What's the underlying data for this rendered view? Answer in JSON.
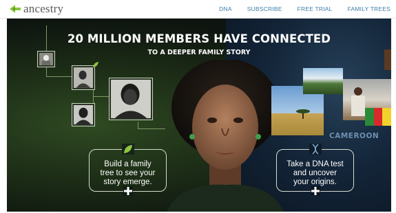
{
  "header": {
    "logo_text": "ancestry",
    "nav": [
      "DNA",
      "SUBSCRIBE",
      "FREE TRIAL",
      "FAMILY TREES"
    ],
    "link_color": "#3d7ea6"
  },
  "hero": {
    "headline": "20 MILLION MEMBERS HAVE CONNECTED",
    "subhead": "TO A DEEPER FAMILY STORY",
    "location_label": "CAMEROON",
    "cta_tree": {
      "text": "Build a family\ntree to see your\nstory emerge.",
      "icon": "leaf-icon"
    },
    "cta_dna": {
      "text": "Take a DNA test\nand uncover\nyour origins.",
      "icon": "dna-icon"
    }
  },
  "colors": {
    "accent_green": "#8cc63f",
    "brand_blue": "#3d7ea6"
  }
}
